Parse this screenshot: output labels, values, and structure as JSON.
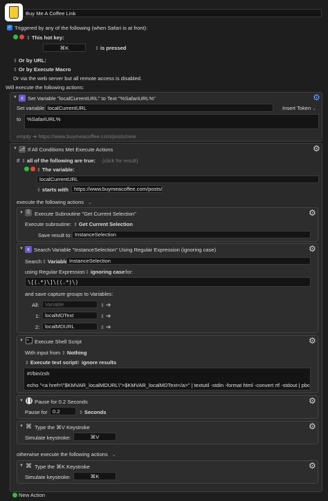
{
  "macro": {
    "name": "Buy Me A Coffee Link"
  },
  "trigger": {
    "label": "Triggered by any of the following (when Safari is at front):",
    "hotkey_label": "This hot key:",
    "hotkey_value": "⌘K",
    "hotkey_mode": "is pressed",
    "url_label": "Or by URL:",
    "exec_macro_label": "Or by Execute Macro",
    "webserver_note": "Or via the web server but all remote access is disabled."
  },
  "will_execute": "Will execute the following actions:",
  "action1": {
    "title": "Set Variable \"localCurrentURL\" to Text \"%SafariURL%\"",
    "set_label": "Set variable",
    "var_value": "localCurrentURL",
    "insert_token": "Insert Token",
    "to_label": "to",
    "to_value": "%SafariURL%",
    "preview_label": "empty",
    "preview_arrow": "➜",
    "preview_value": "https://www.buymeacoffee.com/posts/new"
  },
  "action2": {
    "title": "If All Conditions Met Execute Actions",
    "if_label": "If",
    "all_label": "all of the following are true:",
    "click_hint": "(click for result)",
    "the_variable": "The variable:",
    "var_value": "localCurrentURL",
    "starts_with": "starts with",
    "starts_value": "https://www.buymeacoffee.com/posts/",
    "execute_label": "execute the following actions",
    "otherwise_label": "otherwise execute the following actions"
  },
  "sub1": {
    "title": "Execute Subroutine \"Get Current Selection\"",
    "exec_label": "Execute subroutine:",
    "exec_value": "Get Current Selection",
    "save_label": "Save result to:",
    "save_value": "InstanceSelection"
  },
  "sub2": {
    "title": "Search Variable \"InstanceSelection\" Using Regular Expression (ignoring case)",
    "search_label": "Search",
    "search_type": "Variable",
    "search_value": "InstanceSelection",
    "using_label": "using Regular Expression",
    "ignoring_case": "ignoring case",
    "for_label": "for:",
    "regex": "\\[(.*)\\]\\((.*)\\)",
    "capture_label": "and save capture groups to Variables:",
    "rows": [
      {
        "label": "All:",
        "value": "Variable",
        "placeholder": true
      },
      {
        "label": "1:",
        "value": "localMDText",
        "placeholder": false
      },
      {
        "label": "2:",
        "value": "localMDURL",
        "placeholder": false
      }
    ]
  },
  "sub3": {
    "title": "Execute Shell Script",
    "input_label": "With input from",
    "input_value": "Nothing",
    "exec_type": "Execute text script",
    "ignore_results": "ignore results",
    "line1": "#!/bin/zsh",
    "line2": "echo \"<a href=\\\"$KMVAR_localMDURL\\\">$KMVAR_localMDText</a>\" | textutil -stdin -format html -convert rtf -stdout | pbcopy"
  },
  "sub4": {
    "title": "Pause for 0.2 Seconds",
    "pause_label": "Pause for",
    "pause_value": "0.2",
    "unit": "Seconds"
  },
  "sub5": {
    "title": "Type the ⌘V Keystroke",
    "sim_label": "Simulate keystroke:",
    "key": "⌘V"
  },
  "sub6": {
    "title": "Type the ⌘K Keystroke",
    "sim_label": "Simulate keystroke:",
    "key": "⌘K"
  },
  "new_action": "New Action"
}
